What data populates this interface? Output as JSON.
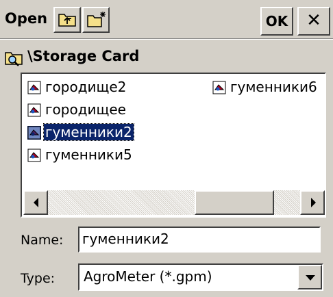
{
  "dialog": {
    "title": "Open",
    "ok_label": "OK",
    "close_label": "✕"
  },
  "icons": {
    "up_folder": "up-folder-icon",
    "new_folder": "new-folder-icon",
    "path_folder": "folder-search-icon",
    "file": "file-icon"
  },
  "path": "\\Storage Card",
  "files": [
    {
      "name": "городище2",
      "selected": false
    },
    {
      "name": "городищее",
      "selected": false
    },
    {
      "name": "гуменники2",
      "selected": true
    },
    {
      "name": "гуменники5",
      "selected": false
    },
    {
      "name": "гуменники6",
      "selected": false
    }
  ],
  "fields": {
    "name_label": "Name:",
    "name_value": "гуменники2",
    "type_label": "Type:",
    "type_value": "AgroMeter (*.gpm)"
  },
  "colors": {
    "selection": "#0a246a",
    "face": "#d4d0c8"
  }
}
